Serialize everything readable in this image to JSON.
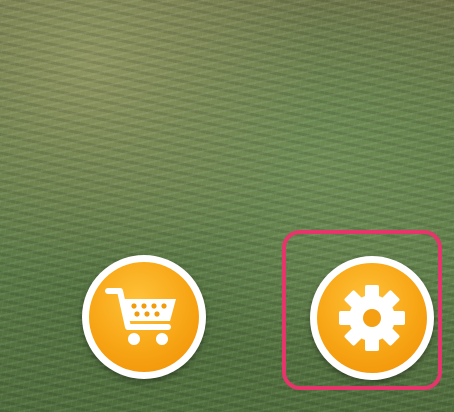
{
  "background": {
    "description_icon": "grass-texture",
    "colors": [
      "#6e7348",
      "#5c7b47",
      "#4e6a3b"
    ]
  },
  "buttons": [
    {
      "icon": "shopping-cart-icon",
      "color": "#f7a514"
    },
    {
      "icon": "gear-icon",
      "color": "#f7a514"
    }
  ],
  "highlight": {
    "color": "#e5356a",
    "target": "gear-icon"
  }
}
